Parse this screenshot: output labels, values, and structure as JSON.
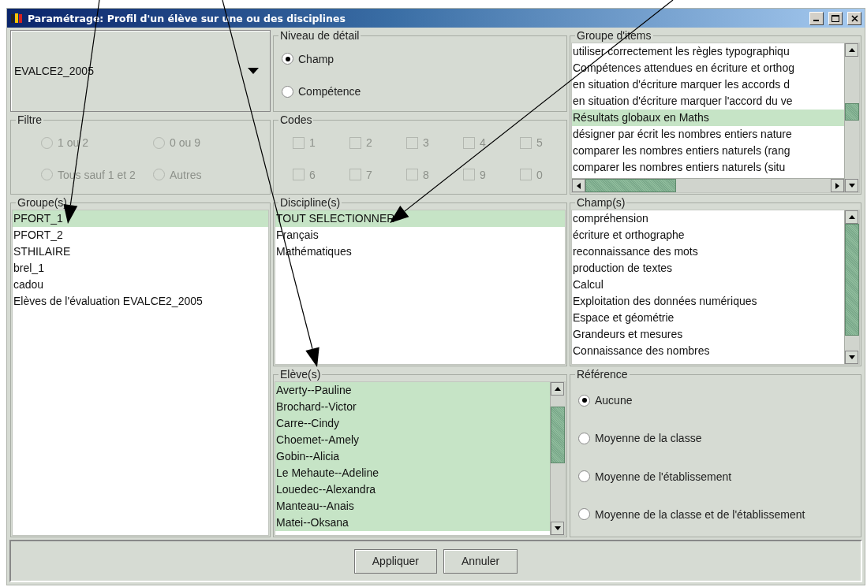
{
  "window": {
    "title": "Paramétrage: Profil d'un élève sur une ou des disciplines"
  },
  "evaluation": {
    "value": "EVALCE2_2005"
  },
  "detail_level": {
    "title": "Niveau de détail",
    "options": [
      {
        "label": "Champ",
        "selected": true
      },
      {
        "label": "Compétence",
        "selected": false
      }
    ]
  },
  "item_groups": {
    "title": "Groupe d'items",
    "items": [
      {
        "label": "utiliser correctement les règles typographiqu",
        "selected": false
      },
      {
        "label": "Compétences attendues en écriture et orthog",
        "selected": false
      },
      {
        "label": "en situation d'écriture marquer les accords d",
        "selected": false
      },
      {
        "label": "en situation d'écriture marquer l'accord du ve",
        "selected": false
      },
      {
        "label": "Résultats globaux en Maths",
        "selected": true
      },
      {
        "label": "désigner par écrit les nombres entiers nature",
        "selected": false
      },
      {
        "label": "comparer les nombres entiers naturels (rang",
        "selected": false
      },
      {
        "label": "comparer les nombres entiers naturels (situ",
        "selected": false
      }
    ]
  },
  "filter": {
    "title": "Filtre",
    "options": [
      {
        "label": "1 ou 2",
        "selected": false,
        "disabled": true
      },
      {
        "label": "0 ou 9",
        "selected": false,
        "disabled": true
      },
      {
        "label": "Tous sauf 1 et 2",
        "selected": false,
        "disabled": true
      },
      {
        "label": "Autres",
        "selected": false,
        "disabled": true
      }
    ]
  },
  "codes": {
    "title": "Codes",
    "options": [
      {
        "label": "1",
        "checked": false,
        "disabled": true
      },
      {
        "label": "2",
        "checked": false,
        "disabled": true
      },
      {
        "label": "3",
        "checked": false,
        "disabled": true
      },
      {
        "label": "4",
        "checked": false,
        "disabled": true
      },
      {
        "label": "5",
        "checked": false,
        "disabled": true
      },
      {
        "label": "6",
        "checked": false,
        "disabled": true
      },
      {
        "label": "7",
        "checked": false,
        "disabled": true
      },
      {
        "label": "8",
        "checked": false,
        "disabled": true
      },
      {
        "label": "9",
        "checked": false,
        "disabled": true
      },
      {
        "label": "0",
        "checked": false,
        "disabled": true
      }
    ]
  },
  "groups": {
    "title": "Groupe(s)",
    "items": [
      {
        "label": "PFORT_1",
        "selected": true
      },
      {
        "label": "PFORT_2",
        "selected": false
      },
      {
        "label": "STHILAIRE",
        "selected": false
      },
      {
        "label": "brel_1",
        "selected": false
      },
      {
        "label": "cadou",
        "selected": false
      },
      {
        "label": "Elèves de l'évaluation EVALCE2_2005",
        "selected": false
      }
    ]
  },
  "disciplines": {
    "title": "Discipline(s)",
    "items": [
      {
        "label": "TOUT SELECTIONNER",
        "selected": true
      },
      {
        "label": "Français",
        "selected": false
      },
      {
        "label": "Mathématiques",
        "selected": false
      }
    ]
  },
  "fields": {
    "title": "Champ(s)",
    "items": [
      {
        "label": "compréhension",
        "selected": false
      },
      {
        "label": "écriture et orthographe",
        "selected": false
      },
      {
        "label": "reconnaissance des mots",
        "selected": false
      },
      {
        "label": "production de textes",
        "selected": false
      },
      {
        "label": "Calcul",
        "selected": false
      },
      {
        "label": "Exploitation des données numériques",
        "selected": false
      },
      {
        "label": "Espace et géométrie",
        "selected": false
      },
      {
        "label": "Grandeurs et mesures",
        "selected": false
      },
      {
        "label": "Connaissance des nombres",
        "selected": false
      }
    ]
  },
  "students": {
    "title": "Elève(s)",
    "items": [
      {
        "label": "Averty--Pauline",
        "selected": true
      },
      {
        "label": "Brochard--Victor",
        "selected": true
      },
      {
        "label": "Carre--Cindy",
        "selected": true
      },
      {
        "label": "Choemet--Amely",
        "selected": true
      },
      {
        "label": "Gobin--Alicia",
        "selected": true
      },
      {
        "label": "Le Mehaute--Adeline",
        "selected": true
      },
      {
        "label": "Louedec--Alexandra",
        "selected": true
      },
      {
        "label": "Manteau--Anais",
        "selected": true
      },
      {
        "label": "Matei--Oksana",
        "selected": true
      }
    ]
  },
  "reference": {
    "title": "Référence",
    "options": [
      {
        "label": "Aucune",
        "selected": true
      },
      {
        "label": "Moyenne de la classe",
        "selected": false
      },
      {
        "label": "Moyenne de l'établissement",
        "selected": false
      },
      {
        "label": "Moyenne de la classe et de l'établissement",
        "selected": false
      }
    ]
  },
  "buttons": [
    "Appliquer",
    "Annuler"
  ]
}
